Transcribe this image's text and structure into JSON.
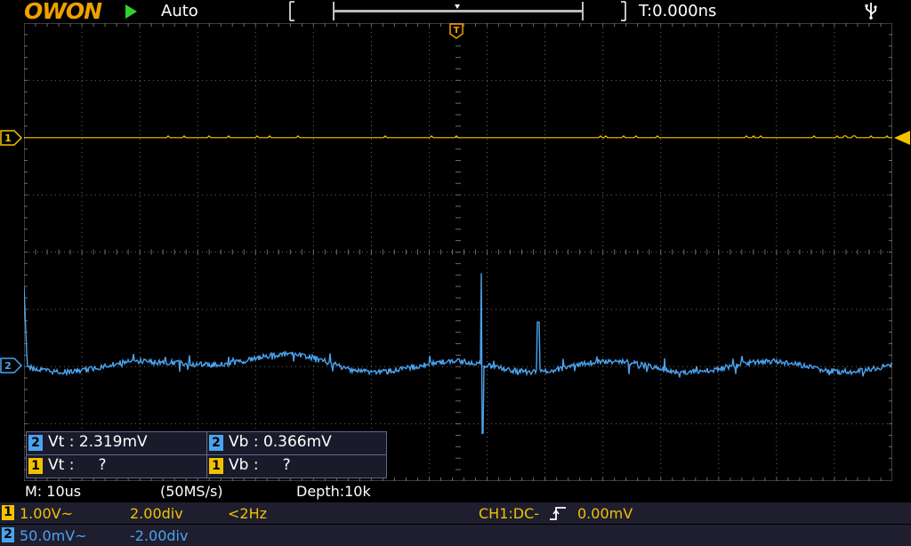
{
  "brand": "OWON",
  "header": {
    "run_state": "running",
    "trigger_mode": "Auto",
    "trigger_time": "T:0.000ns",
    "icons": [
      "run-icon",
      "usb-icon"
    ]
  },
  "trigger_marker": "T",
  "channel_markers": {
    "ch1": "1",
    "ch2": "2"
  },
  "measurements": [
    {
      "ch": "2",
      "label": "Vt : 2.319mV"
    },
    {
      "ch": "2",
      "label": "Vb : 0.366mV"
    },
    {
      "ch": "1",
      "label": "Vt :     ?"
    },
    {
      "ch": "1",
      "label": "Vb :     ?"
    }
  ],
  "status": {
    "timebase": "M: 10us",
    "sample_rate": "(50MS/s)",
    "depth": "Depth:10k"
  },
  "channels": [
    {
      "id": "1",
      "scale": "1.00V~",
      "offset": "2.00div",
      "freq": "<2Hz",
      "trigger": "CH1:DC-",
      "trigger_level": "0.00mV"
    },
    {
      "id": "2",
      "scale": "50.0mV~",
      "offset": "-2.00div"
    }
  ],
  "colors": {
    "ch1": "#f2c200",
    "ch2": "#4aa3ef",
    "grid": "#6b6b6b",
    "logo": "#f0a000",
    "run": "#2fd12f"
  }
}
